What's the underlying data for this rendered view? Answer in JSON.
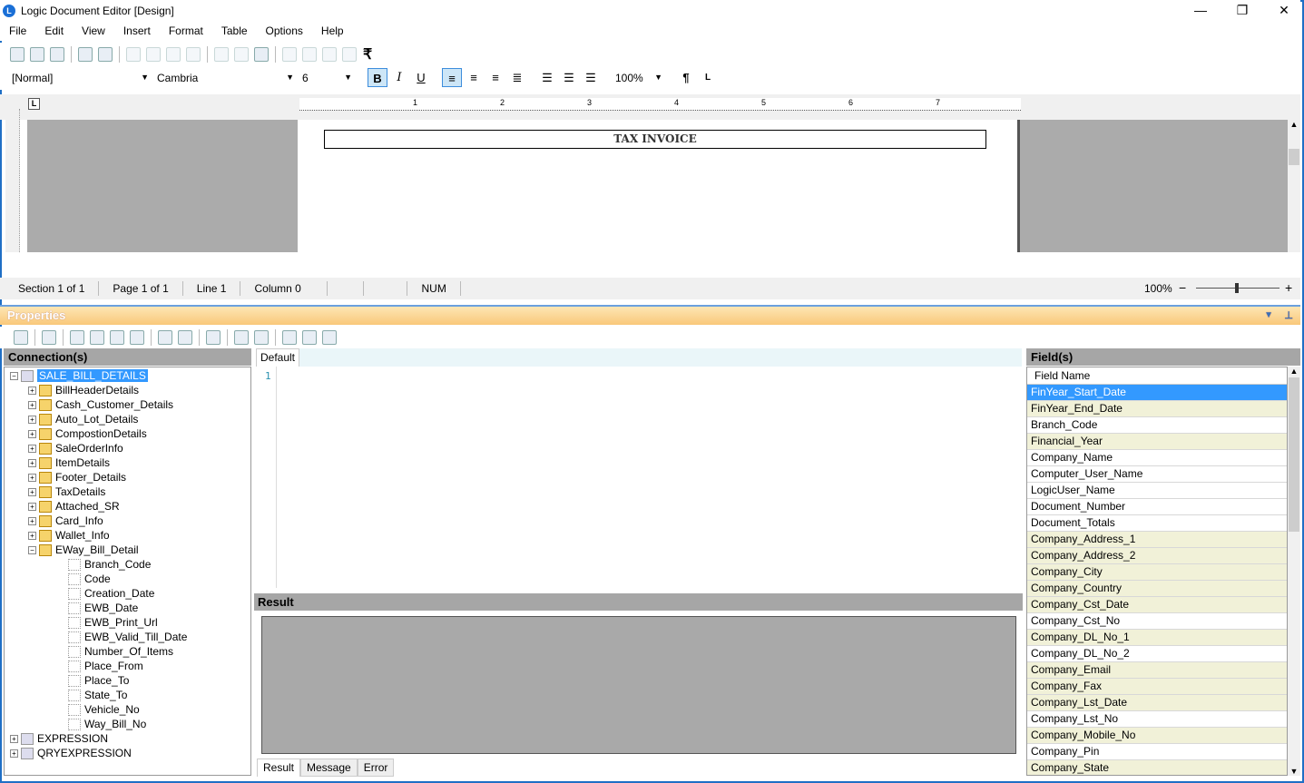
{
  "window": {
    "title": "Logic Document Editor [Design]",
    "app_icon": "L"
  },
  "menu": [
    "File",
    "Edit",
    "View",
    "Insert",
    "Format",
    "Table",
    "Options",
    "Help"
  ],
  "toolbar1": {
    "icons": [
      "new-icon",
      "open-icon",
      "save-icon",
      "print-icon",
      "print-preview-icon",
      "cut-icon",
      "copy-icon",
      "paste-icon",
      "delete-icon",
      "undo-icon",
      "redo-icon",
      "find-icon",
      "outdent-icon",
      "indent-icon",
      "align-icon",
      "fields-icon",
      "rupee-icon"
    ],
    "rupee": "₹"
  },
  "formatbar": {
    "style": "[Normal]",
    "font": "Cambria",
    "size": "6",
    "zoom": "100%",
    "bold": "B",
    "italic": "I",
    "underline": "U",
    "pilcrow": "¶"
  },
  "ruler": {
    "marks": [
      "1",
      "2",
      "3",
      "4",
      "5",
      "6",
      "7"
    ],
    "tab_marker": "L"
  },
  "document": {
    "heading": "TAX INVOICE"
  },
  "status": {
    "section": "Section 1 of 1",
    "page": "Page 1 of 1",
    "line": "Line 1",
    "column": "Column 0",
    "num": "NUM",
    "zoom": "100%",
    "minus": "−",
    "plus": "+"
  },
  "properties": {
    "title": "Properties"
  },
  "connections": {
    "header": "Connection(s)",
    "root": "SALE_BILL_DETAILS",
    "children": [
      "BillHeaderDetails",
      "Cash_Customer_Details",
      "Auto_Lot_Details",
      "CompostionDetails",
      "SaleOrderInfo",
      "ItemDetails",
      "Footer_Details",
      "TaxDetails",
      "Attached_SR",
      "Card_Info",
      "Wallet_Info",
      "EWay_Bill_Detail"
    ],
    "eway_fields": [
      "Branch_Code",
      "Code",
      "Creation_Date",
      "EWB_Date",
      "EWB_Print_Url",
      "EWB_Valid_Till_Date",
      "Number_Of_Items",
      "Place_From",
      "Place_To",
      "State_To",
      "Vehicle_No",
      "Way_Bill_No"
    ],
    "others": [
      "EXPRESSION",
      "QRYEXPRESSION"
    ]
  },
  "editor": {
    "tab": "Default",
    "line_number": "1"
  },
  "result": {
    "header": "Result",
    "tabs": [
      "Result",
      "Message",
      "Error"
    ]
  },
  "fields": {
    "header": "Field(s)",
    "column": "Field Name",
    "items": [
      "FinYear_Start_Date",
      "FinYear_End_Date",
      "Branch_Code",
      "Financial_Year",
      "Company_Name",
      "Computer_User_Name",
      "LogicUser_Name",
      "Document_Number",
      "Document_Totals",
      "Company_Address_1",
      "Company_Address_2",
      "Company_City",
      "Company_Country",
      "Company_Cst_Date",
      "Company_Cst_No",
      "Company_DL_No_1",
      "Company_DL_No_2",
      "Company_Email",
      "Company_Fax",
      "Company_Lst_Date",
      "Company_Lst_No",
      "Company_Mobile_No",
      "Company_Pin",
      "Company_State"
    ]
  }
}
